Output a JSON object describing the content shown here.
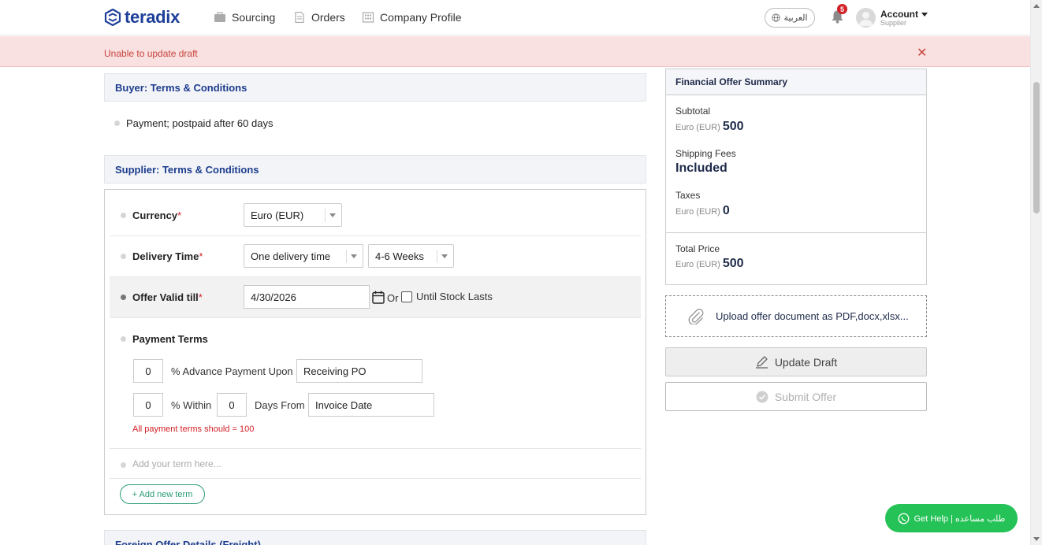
{
  "nav": {
    "logo_text": "teradix",
    "items": [
      {
        "label": "Sourcing",
        "icon": "briefcase-icon"
      },
      {
        "label": "Orders",
        "icon": "document-icon"
      },
      {
        "label": "Company Profile",
        "icon": "building-icon"
      }
    ],
    "language_button": "العربية",
    "notification_count": "5",
    "account_label": "Account",
    "account_role": "Supplier"
  },
  "alert": {
    "message": "Unable to update draft",
    "close_symbol": "✕"
  },
  "buyer_terms": {
    "title": "Buyer: Terms & Conditions",
    "items": [
      "Payment; postpaid after 60 days"
    ]
  },
  "supplier_terms": {
    "title": "Supplier: Terms & Conditions",
    "currency": {
      "label": "Currency",
      "required_mark": "*",
      "value": "Euro (EUR)"
    },
    "delivery_time": {
      "label": "Delivery Time",
      "required_mark": "*",
      "type_value": "One delivery time",
      "period_value": "4-6 Weeks"
    },
    "offer_valid": {
      "label": "Offer Valid till",
      "required_mark": "*",
      "date_value": "4/30/2026",
      "or_text": "Or",
      "stock_label": "Until Stock Lasts",
      "stock_checked": false
    },
    "payment_terms": {
      "label": "Payment Terms",
      "advance_percent": "0",
      "advance_text": "% Advance Payment Upon",
      "advance_upon": "Receiving PO",
      "within_percent": "0",
      "within_text": "% Within",
      "days": "0",
      "days_from_text": "Days From",
      "days_from_value": "Invoice Date",
      "error": "All payment terms should = 100"
    },
    "new_term_placeholder": "Add your term here...",
    "add_new_term_button": "+ Add new term"
  },
  "foreign_offer": {
    "title": "Foreign Offer Details (Freight)"
  },
  "summary": {
    "title": "Financial Offer Summary",
    "subtotal_label": "Subtotal",
    "subtotal_currency": "Euro (EUR)",
    "subtotal_value": "500",
    "shipping_label": "Shipping Fees",
    "shipping_value": "Included",
    "taxes_label": "Taxes",
    "taxes_currency": "Euro (EUR)",
    "taxes_value": "0",
    "total_label": "Total Price",
    "total_currency": "Euro (EUR)",
    "total_value": "500"
  },
  "upload": {
    "label": "Upload offer document as PDF,docx,xlsx..."
  },
  "buttons": {
    "update_draft": "Update Draft",
    "submit_offer": "Submit Offer"
  },
  "help": {
    "label": "Get Help | طلب مساعده"
  },
  "colors": {
    "brand": "#1e3f9a",
    "section_title": "#1c3d8c",
    "error": "#d21f25",
    "alert_bg": "#f9e1e1",
    "accent_green": "#2a9c74",
    "whatsapp_green": "#25c257"
  }
}
